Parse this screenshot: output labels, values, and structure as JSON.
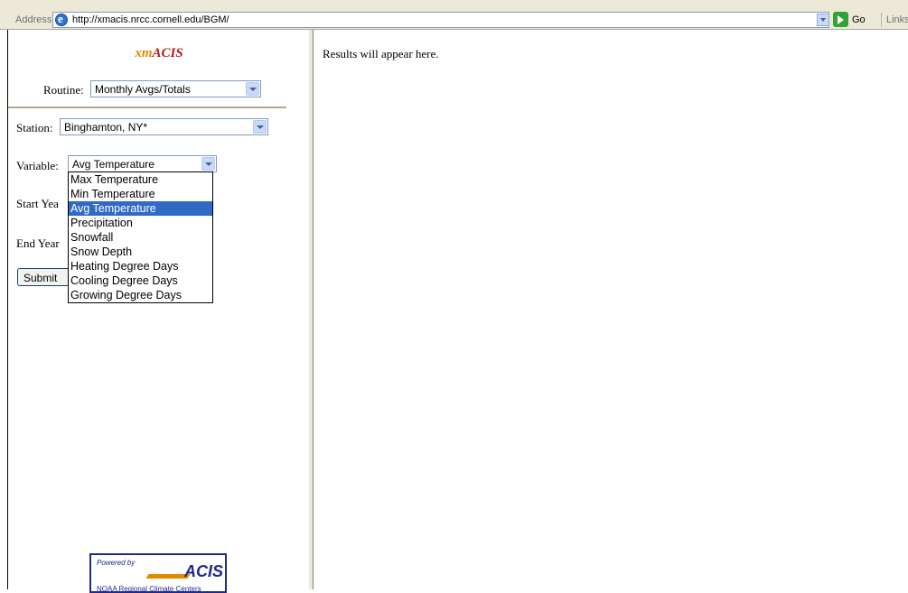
{
  "address_bar": {
    "label": "Address",
    "url": "http://xmacis.nrcc.cornell.edu/BGM/",
    "go_label": "Go",
    "links_label": "Links"
  },
  "app": {
    "title_prefix": "xm",
    "title_main": "ACIS"
  },
  "form": {
    "routine_label": "Routine:",
    "routine_value": "Monthly Avgs/Totals",
    "station_label": "Station:",
    "station_value": "Binghamton, NY*",
    "variable_label": "Variable:",
    "variable_value": "Avg Temperature",
    "start_year_label": "Start Yea",
    "end_year_label": "End Year",
    "submit_label": "Submit"
  },
  "variable_options": [
    "Max Temperature",
    "Min Temperature",
    "Avg Temperature",
    "Precipitation",
    "Snowfall",
    "Snow Depth",
    "Heating Degree Days",
    "Cooling Degree Days",
    "Growing Degree Days"
  ],
  "selected_variable_index": 2,
  "results": {
    "placeholder": "Results will appear here."
  },
  "logo": {
    "powered_by": "Powered by",
    "name": "ACIS",
    "subtitle": "NOAA Regional Climate Centers"
  },
  "colors": {
    "title_prefix": "#e08a00",
    "title_main": "#b31b1b",
    "selection": "#316ac5"
  }
}
